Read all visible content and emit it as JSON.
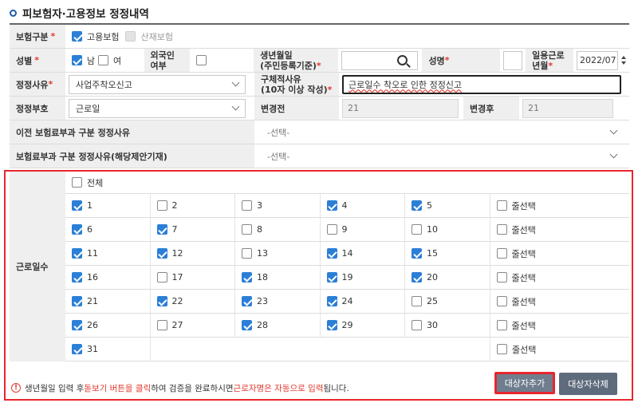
{
  "title": "피보험자·고용정보 정정내역",
  "insurance": {
    "label": "보험구분",
    "options": [
      {
        "label": "고용보험",
        "checked": true
      },
      {
        "label": "산재보험",
        "checked": false,
        "disabled": true
      }
    ]
  },
  "gender": {
    "label": "성별",
    "male": "남",
    "female": "여",
    "male_checked": true
  },
  "foreigner": {
    "label_line1": "외국인",
    "label_line2": "여부"
  },
  "birth": {
    "label_line1": "생년월일",
    "label_line2": "(주민등록기준)",
    "value": ""
  },
  "name": {
    "label": "성명",
    "value": ""
  },
  "work_month": {
    "label_line1": "일용근로",
    "label_line2": "년월",
    "value": "2022/07"
  },
  "correction_reason": {
    "label": "정정사유",
    "value": "사업주착오신고"
  },
  "detail_reason": {
    "label_line1": "구체적사유",
    "label_line2": "(10자 이상 작성)",
    "value": "근로일수 착오로 인한 정정신고"
  },
  "correction_number": {
    "label": "정정부호",
    "value": "근로일"
  },
  "before": {
    "label": "변경전",
    "value": "21"
  },
  "after": {
    "label": "변경후",
    "value": "21"
  },
  "prev_reason": {
    "label": "이전 보험료부과 구분 정정사유",
    "value": "-선택-"
  },
  "curr_reason": {
    "label": "보험료부과 구분 정정사유(해당제안기재)",
    "value": "-선택-"
  },
  "work_days": {
    "label": "근로일수",
    "all_label": "전체",
    "row_select_label": "줄선택",
    "days": [
      {
        "d": "1",
        "c": true
      },
      {
        "d": "2",
        "c": false
      },
      {
        "d": "3",
        "c": false
      },
      {
        "d": "4",
        "c": true
      },
      {
        "d": "5",
        "c": true
      },
      {
        "d": "6",
        "c": true
      },
      {
        "d": "7",
        "c": true
      },
      {
        "d": "8",
        "c": false
      },
      {
        "d": "9",
        "c": false
      },
      {
        "d": "10",
        "c": false
      },
      {
        "d": "11",
        "c": true
      },
      {
        "d": "12",
        "c": true
      },
      {
        "d": "13",
        "c": false
      },
      {
        "d": "14",
        "c": true
      },
      {
        "d": "15",
        "c": true
      },
      {
        "d": "16",
        "c": true
      },
      {
        "d": "17",
        "c": false
      },
      {
        "d": "18",
        "c": true
      },
      {
        "d": "19",
        "c": true
      },
      {
        "d": "20",
        "c": true
      },
      {
        "d": "21",
        "c": true
      },
      {
        "d": "22",
        "c": true
      },
      {
        "d": "23",
        "c": true
      },
      {
        "d": "24",
        "c": true
      },
      {
        "d": "25",
        "c": false
      },
      {
        "d": "26",
        "c": true
      },
      {
        "d": "27",
        "c": false
      },
      {
        "d": "28",
        "c": true
      },
      {
        "d": "29",
        "c": true
      },
      {
        "d": "30",
        "c": false
      },
      {
        "d": "31",
        "c": true
      }
    ]
  },
  "notice": {
    "p1": "생년월일 입력 후 ",
    "h1": "돋보기 버튼을 클릭",
    "p2": "하여 검증을 완료하시면 ",
    "h2": "근로자명은 자동으로 입력",
    "p3": "됩니다."
  },
  "buttons": {
    "add": "대상자추가",
    "delete": "대상자삭제"
  },
  "colors": {
    "accent_red": "#e8262d",
    "check_blue": "#2b7fd6",
    "button_gray": "#6f7d8e"
  }
}
